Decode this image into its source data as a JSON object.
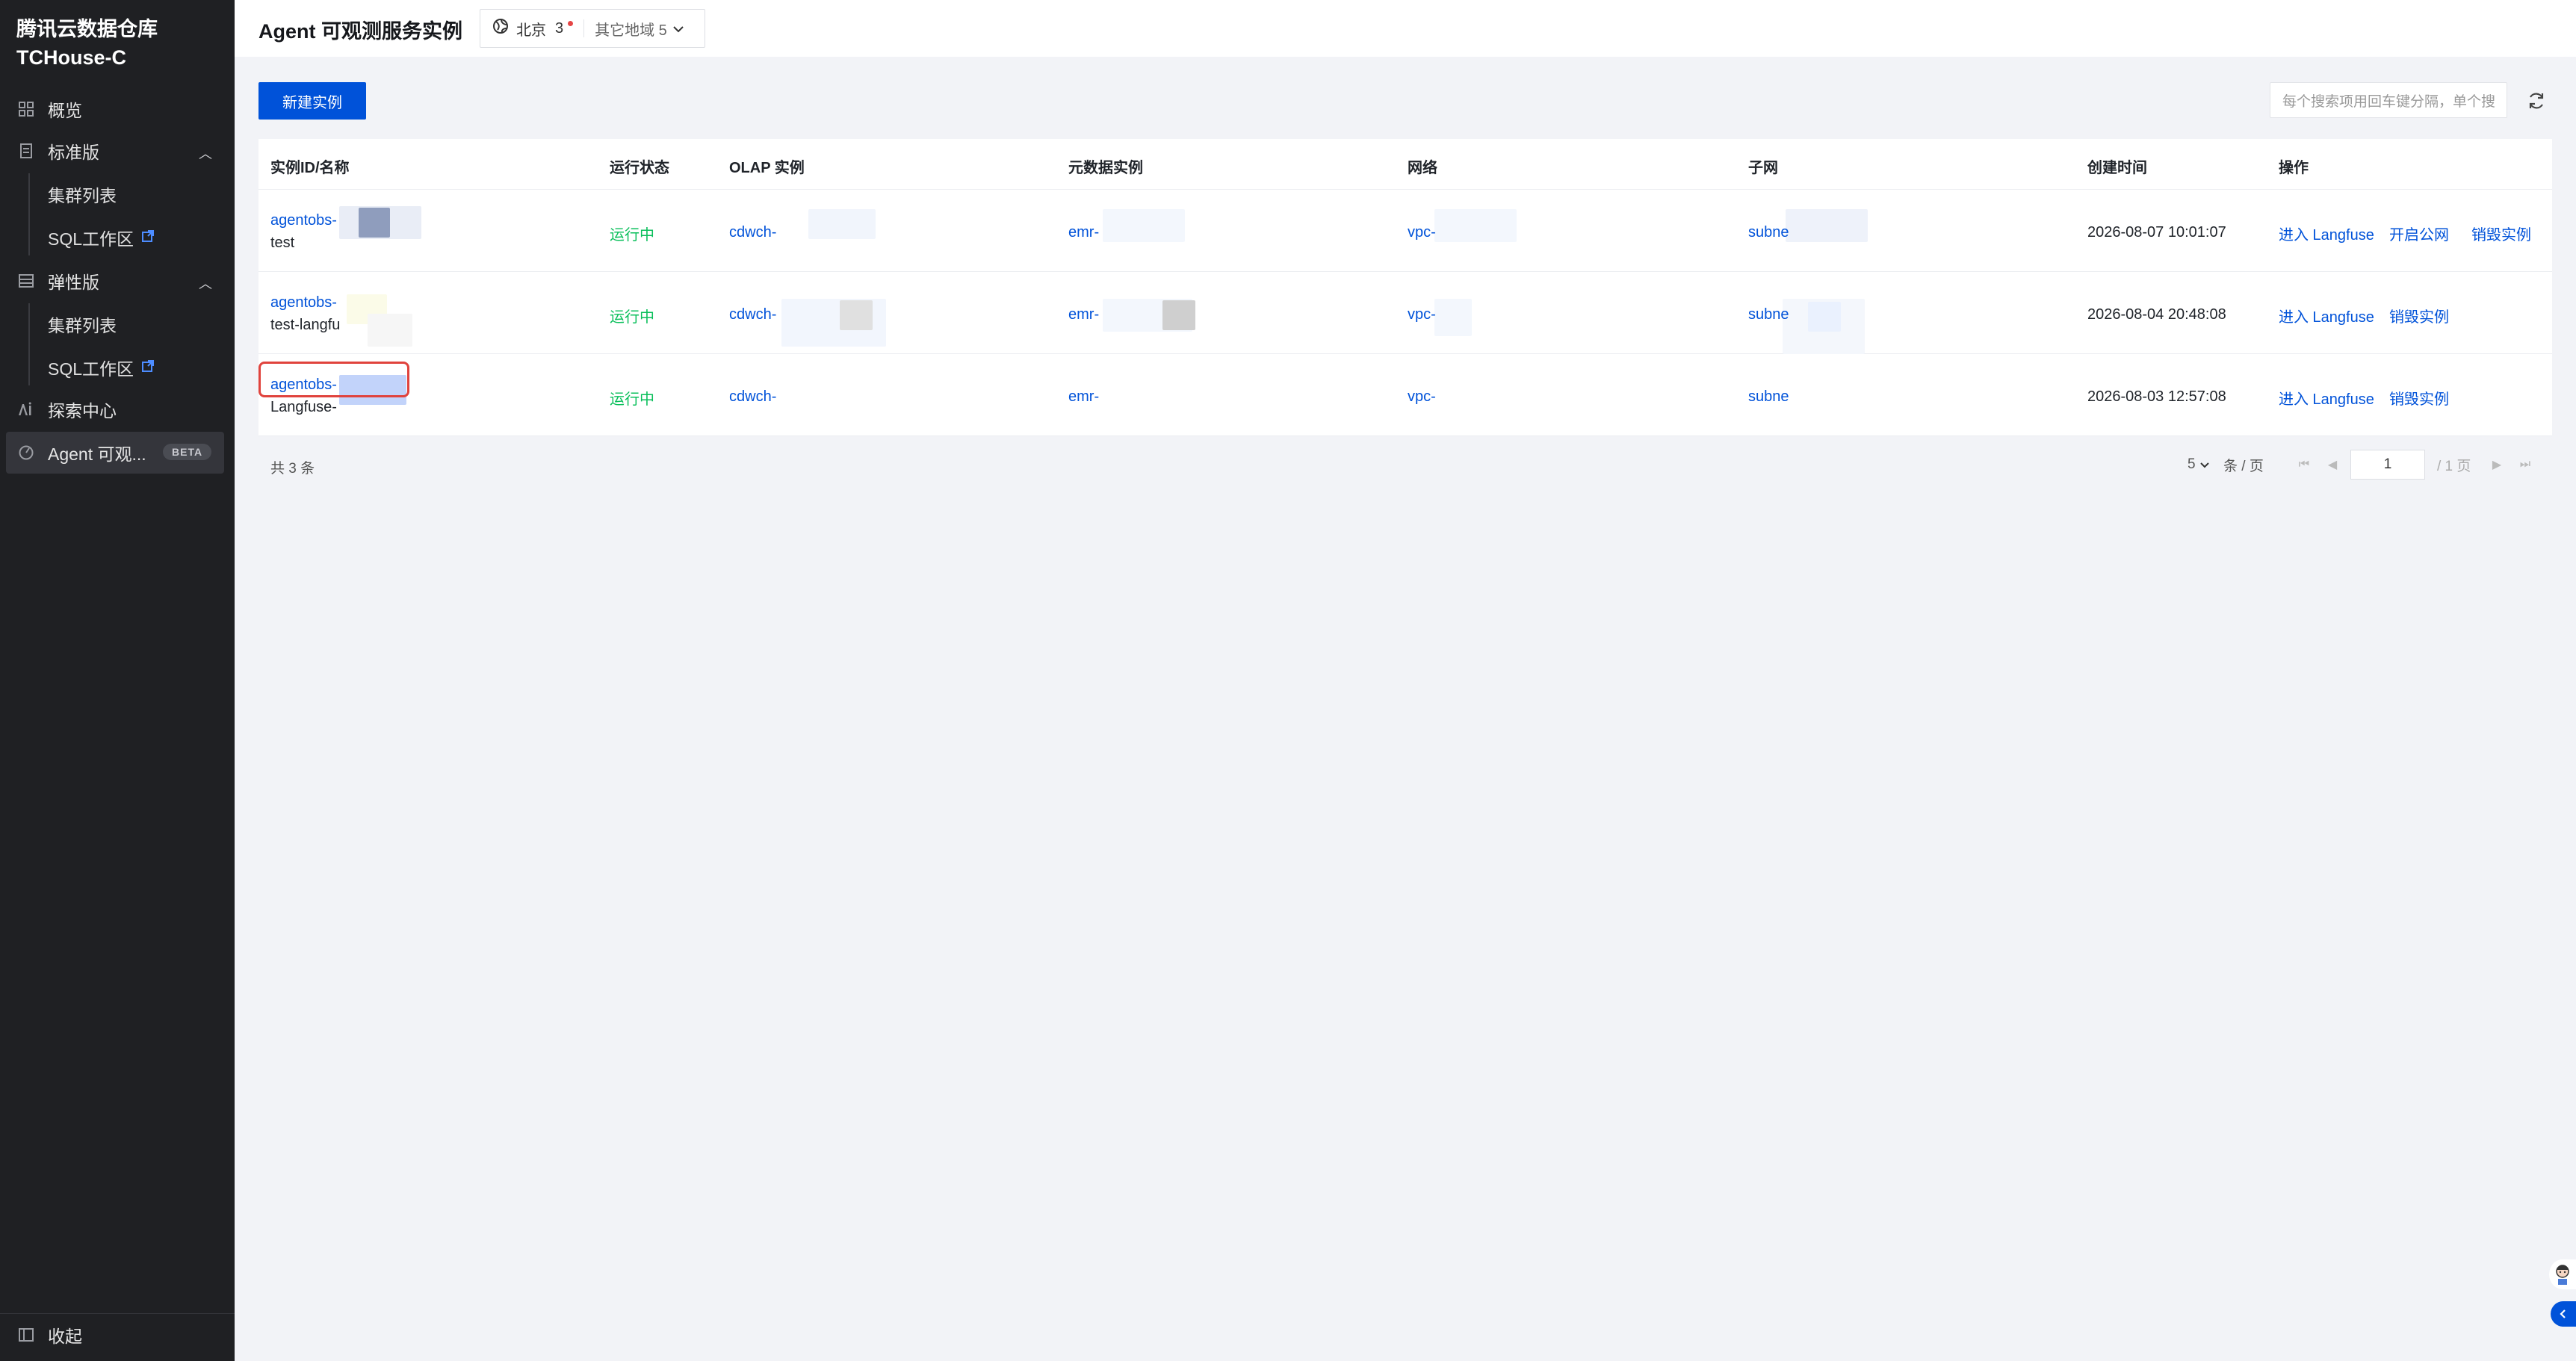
{
  "sidebar": {
    "brand_line1": "腾讯云数据仓库",
    "brand_line2": "TCHouse-C",
    "overview": "概览",
    "standard": "标准版",
    "standard_cluster_list": "集群列表",
    "standard_sql": "SQL工作区",
    "elastic": "弹性版",
    "elastic_cluster_list": "集群列表",
    "elastic_sql": "SQL工作区",
    "explore": "探索中心",
    "agent": "Agent 可观...",
    "beta": "BETA",
    "collapse": "收起"
  },
  "header": {
    "title": "Agent 可观测服务实例",
    "region_name": "北京",
    "region_count": "3",
    "other_regions": "其它地域 5"
  },
  "toolbar": {
    "new_button": "新建实例",
    "search_placeholder": "每个搜索项用回车键分隔，单个搜"
  },
  "table": {
    "headers": {
      "id": "实例ID/名称",
      "status": "运行状态",
      "olap": "OLAP 实例",
      "meta": "元数据实例",
      "network": "网络",
      "subnet": "子网",
      "created": "创建时间",
      "actions": "操作"
    },
    "rows": [
      {
        "id": "agentobs-",
        "name": "test",
        "status": "运行中",
        "olap": "cdwch-",
        "meta": "emr-",
        "vpc": "vpc-",
        "subnet": "subne",
        "created": "2026-08-07 10:01:07",
        "action1": "进入 Langfuse",
        "action2": "开启公网",
        "action3": "销毁实例"
      },
      {
        "id": "agentobs-",
        "name": "test-langfu",
        "status": "运行中",
        "olap": "cdwch-",
        "meta": "emr-",
        "vpc": "vpc-",
        "subnet": "subne",
        "created": "2026-08-04 20:48:08",
        "action1": "进入 Langfuse",
        "action2": "销毁实例"
      },
      {
        "id": "agentobs-",
        "name": "Langfuse-",
        "status": "运行中",
        "olap": "cdwch-",
        "meta": "emr-",
        "vpc": "vpc-",
        "subnet": "subne",
        "created": "2026-08-03 12:57:08",
        "action1": "进入 Langfuse",
        "action2": "销毁实例"
      }
    ]
  },
  "pagination": {
    "total": "共 3 条",
    "page_size": "5",
    "per_page": "条 / 页",
    "current": "1",
    "of_pages": "/ 1 页"
  },
  "colors": {
    "primary": "#0052d9",
    "running": "#0abf5b",
    "sidebar_bg": "#1f2023",
    "highlight": "#e0433d"
  }
}
